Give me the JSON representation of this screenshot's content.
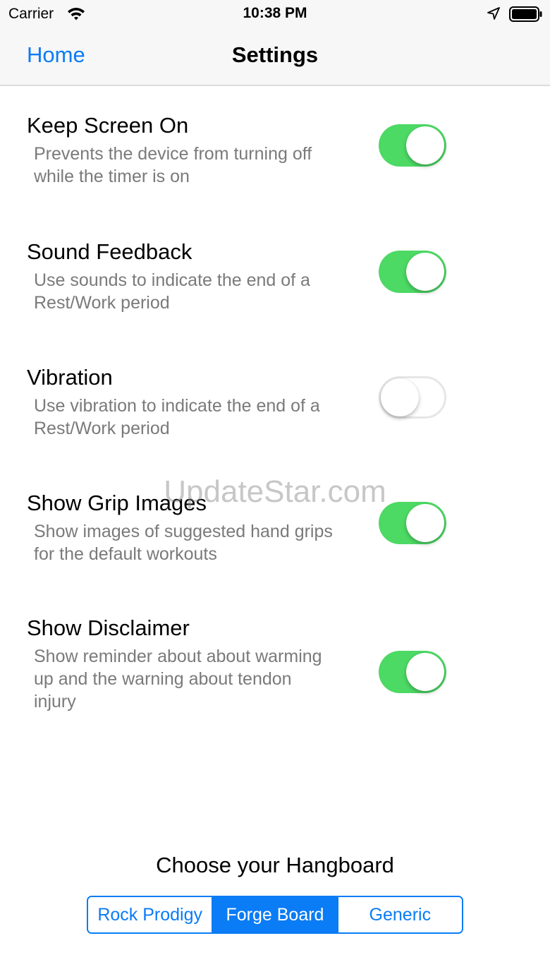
{
  "status_bar": {
    "carrier": "Carrier",
    "time": "10:38 PM",
    "icons": [
      "wifi-icon",
      "location-icon",
      "battery-icon"
    ]
  },
  "nav": {
    "back_label": "Home",
    "title": "Settings"
  },
  "settings": [
    {
      "title": "Keep Screen On",
      "description": "Prevents the device from turning off while the timer is on",
      "enabled": true
    },
    {
      "title": "Sound Feedback",
      "description": "Use sounds to indicate the end of a Rest/Work period",
      "enabled": true
    },
    {
      "title": "Vibration",
      "description": "Use vibration to indicate the end of a Rest/Work period",
      "enabled": false
    },
    {
      "title": "Show Grip Images",
      "description": "Show images of suggested hand grips for the default workouts",
      "enabled": true
    },
    {
      "title": "Show Disclaimer",
      "description": "Show reminder about about warming up and the warning about tendon injury",
      "enabled": true
    }
  ],
  "watermark": "UpdateStar.com",
  "hangboard": {
    "label": "Choose your Hangboard",
    "options": [
      "Rock Prodigy",
      "Forge Board",
      "Generic"
    ],
    "selected": "Forge Board"
  },
  "colors": {
    "accent": "#0a7cf5",
    "toggle_on": "#4cd964",
    "toggle_off_border": "#e6e6e6",
    "description_text": "#7a7a7a",
    "bar_background": "#f7f7f7"
  }
}
